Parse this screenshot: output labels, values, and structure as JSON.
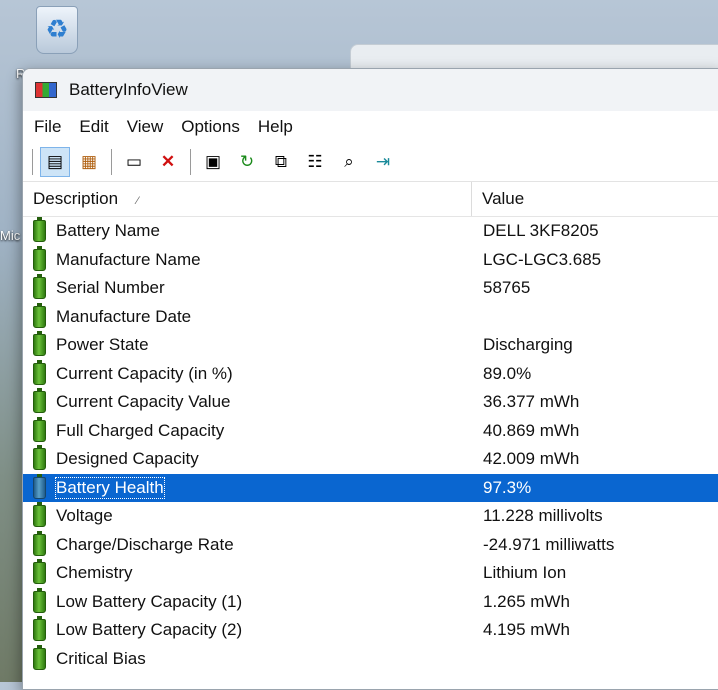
{
  "desktop": {
    "label1": "R",
    "label2": "Mic"
  },
  "window": {
    "title": "BatteryInfoView"
  },
  "menu": [
    "File",
    "Edit",
    "View",
    "Options",
    "Help"
  ],
  "toolbar": {
    "icons": [
      "properties-view-icon",
      "list-view-icon",
      "html-report-icon",
      "delete-icon",
      "save-icon",
      "refresh-icon",
      "copy-icon",
      "options-icon",
      "find-icon",
      "exit-icon"
    ]
  },
  "columns": {
    "description": "Description",
    "value": "Value"
  },
  "rows": [
    {
      "description": "Battery Name",
      "value": "DELL 3KF8205"
    },
    {
      "description": "Manufacture Name",
      "value": "LGC-LGC3.685"
    },
    {
      "description": "Serial Number",
      "value": "58765"
    },
    {
      "description": "Manufacture Date",
      "value": ""
    },
    {
      "description": "Power State",
      "value": "Discharging"
    },
    {
      "description": "Current Capacity (in %)",
      "value": "89.0%"
    },
    {
      "description": "Current Capacity Value",
      "value": "36.377 mWh"
    },
    {
      "description": "Full Charged Capacity",
      "value": "40.869 mWh"
    },
    {
      "description": "Designed Capacity",
      "value": "42.009 mWh"
    },
    {
      "description": "Battery Health",
      "value": "97.3%",
      "selected": true
    },
    {
      "description": "Voltage",
      "value": "11.228 millivolts"
    },
    {
      "description": "Charge/Discharge Rate",
      "value": "-24.971 milliwatts"
    },
    {
      "description": "Chemistry",
      "value": "Lithium Ion"
    },
    {
      "description": "Low Battery Capacity (1)",
      "value": "1.265 mWh"
    },
    {
      "description": "Low Battery Capacity (2)",
      "value": "4.195 mWh"
    },
    {
      "description": "Critical Bias",
      "value": ""
    }
  ],
  "colors": {
    "selection": "#0a66d0",
    "battery_icon": "#4aa51f"
  }
}
